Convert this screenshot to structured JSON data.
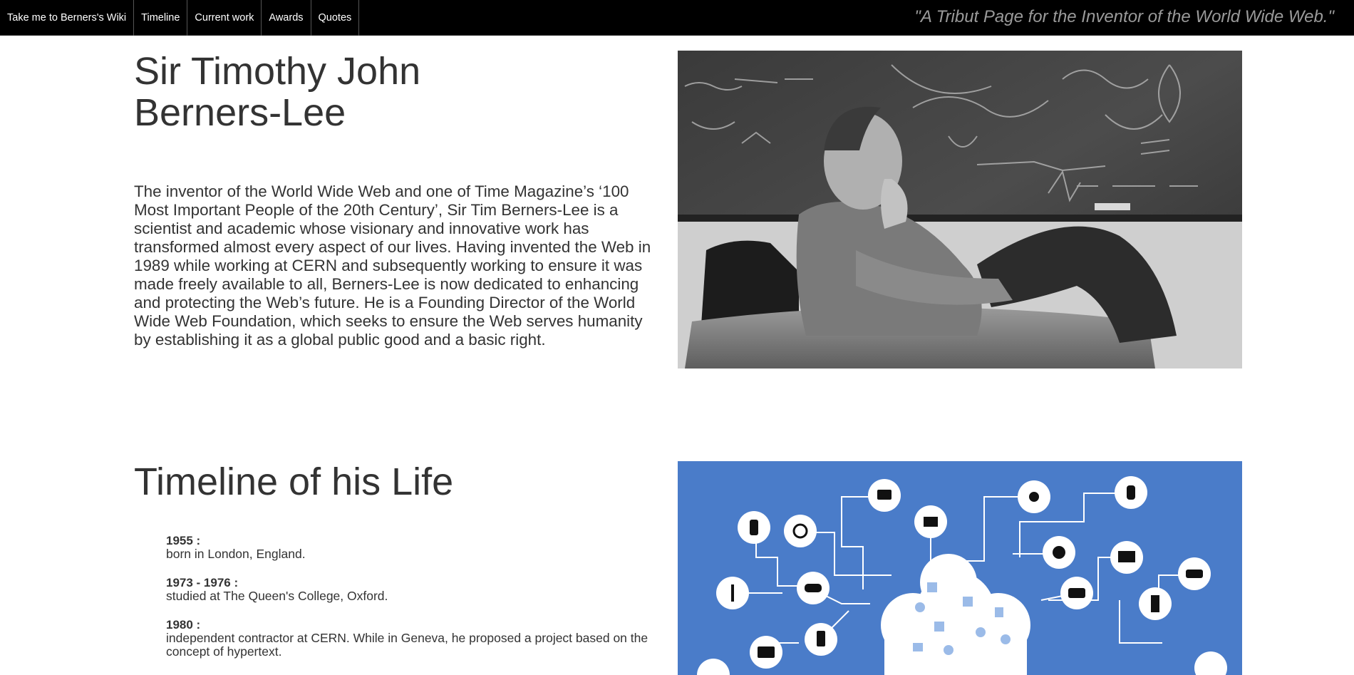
{
  "nav": {
    "links": [
      "Take me to Berners's Wiki",
      "Timeline",
      "Current work",
      "Awards",
      "Quotes"
    ],
    "tagline": "\"A Tribut Page for the Inventor of the World Wide Web.\""
  },
  "hero": {
    "title_line1": "Sir Timothy John",
    "title_line2": "Berners-Lee",
    "bio": "The inventor of the World Wide Web and one of Time Magazine’s ‘100 Most Important People of the 20th Century’, Sir Tim Berners-Lee is a scientist and academic whose visionary and innovative work has transformed almost every aspect of our lives. Having invented the Web in 1989 while working at CERN and subsequently working to ensure it was made freely available to all, Berners-Lee is now dedicated to enhancing and protecting the Web’s future. He is a Founding Director of the World Wide Web Foundation, which seeks to ensure the Web serves humanity by establishing it as a global public good and a basic right."
  },
  "timeline": {
    "title": "Timeline of his Life",
    "items": [
      {
        "date": "1955 :",
        "desc": "born in London, England."
      },
      {
        "date": "1973 - 1976 :",
        "desc": "studied at The Queen's College, Oxford."
      },
      {
        "date": "1980 :",
        "desc": "independent contractor at CERN. While in Geneva, he proposed a project based on the concept of hypertext."
      }
    ]
  },
  "colors": {
    "nav_bg": "#000000",
    "network_bg": "#4a7cc9",
    "text": "#333333",
    "tagline": "#9a9a9a"
  }
}
